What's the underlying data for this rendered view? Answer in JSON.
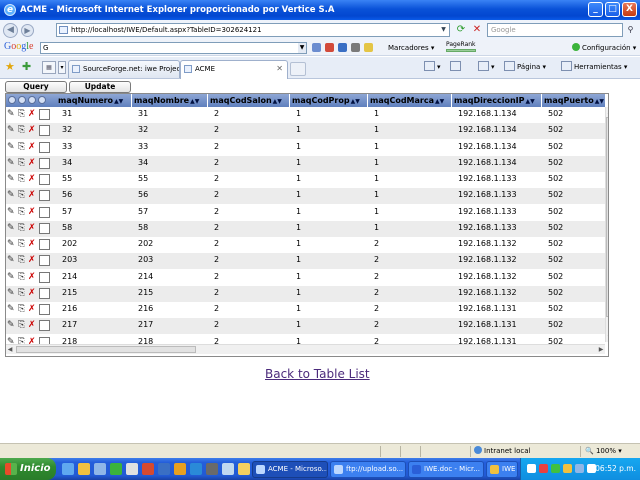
{
  "window": {
    "title": "ACME - Microsoft Internet Explorer proporcionado por Vertice S.A",
    "minimize": "_",
    "maximize": "□",
    "close": "X"
  },
  "address_bar": {
    "url": "http://localhost/IWE/Default.aspx?TableID=302624121",
    "search_placeholder": "Google"
  },
  "google_toolbar": {
    "logo": [
      "G",
      "o",
      "o",
      "g",
      "l",
      "e"
    ],
    "search_value": "G",
    "bookmarks_label": "Marcadores",
    "pagerank_label": "PageRank",
    "settings_label": "Configuración"
  },
  "tabs": [
    {
      "label": "SourceForge.net: iwe Projec..."
    },
    {
      "label": "ACME"
    }
  ],
  "command_bar": {
    "page_label": "Página",
    "tools_label": "Herramientas"
  },
  "actions": {
    "query_label": "Query",
    "update_label": "Update"
  },
  "grid": {
    "columns": [
      "maqNumero",
      "maqNombre",
      "maqCodSalon",
      "maqCodProp",
      "maqCodMarca",
      "maqDireccionIP",
      "maqPuerto"
    ],
    "rows": [
      [
        "31",
        "31",
        "2",
        "1",
        "1",
        "192.168.1.134",
        "502"
      ],
      [
        "32",
        "32",
        "2",
        "1",
        "1",
        "192.168.1.134",
        "502"
      ],
      [
        "33",
        "33",
        "2",
        "1",
        "1",
        "192.168.1.134",
        "502"
      ],
      [
        "34",
        "34",
        "2",
        "1",
        "1",
        "192.168.1.134",
        "502"
      ],
      [
        "55",
        "55",
        "2",
        "1",
        "1",
        "192.168.1.133",
        "502"
      ],
      [
        "56",
        "56",
        "2",
        "1",
        "1",
        "192.168.1.133",
        "502"
      ],
      [
        "57",
        "57",
        "2",
        "1",
        "1",
        "192.168.1.133",
        "502"
      ],
      [
        "58",
        "58",
        "2",
        "1",
        "1",
        "192.168.1.133",
        "502"
      ],
      [
        "202",
        "202",
        "2",
        "1",
        "2",
        "192.168.1.132",
        "502"
      ],
      [
        "203",
        "203",
        "2",
        "1",
        "2",
        "192.168.1.132",
        "502"
      ],
      [
        "214",
        "214",
        "2",
        "1",
        "2",
        "192.168.1.132",
        "502"
      ],
      [
        "215",
        "215",
        "2",
        "1",
        "2",
        "192.168.1.132",
        "502"
      ],
      [
        "216",
        "216",
        "2",
        "1",
        "2",
        "192.168.1.131",
        "502"
      ],
      [
        "217",
        "217",
        "2",
        "1",
        "2",
        "192.168.1.131",
        "502"
      ],
      [
        "218",
        "218",
        "2",
        "1",
        "2",
        "192.168.1.131",
        "502"
      ]
    ]
  },
  "back_link": "Back to Table List",
  "status_bar": {
    "zone": "Intranet local",
    "zoom": "100%"
  },
  "taskbar": {
    "start_label": "Inicio",
    "tasks": [
      {
        "label": "ACME - Microso..."
      },
      {
        "label": "ftp://upload.so..."
      },
      {
        "label": "IWE.doc - Micr..."
      },
      {
        "label": "IWE"
      }
    ],
    "clock": "06:52 p.m."
  },
  "colors": {
    "titlebar": "#0a52d8",
    "grid_header": "#7a95cc",
    "row_alt": "#ececec",
    "link": "#4b2a7b"
  }
}
